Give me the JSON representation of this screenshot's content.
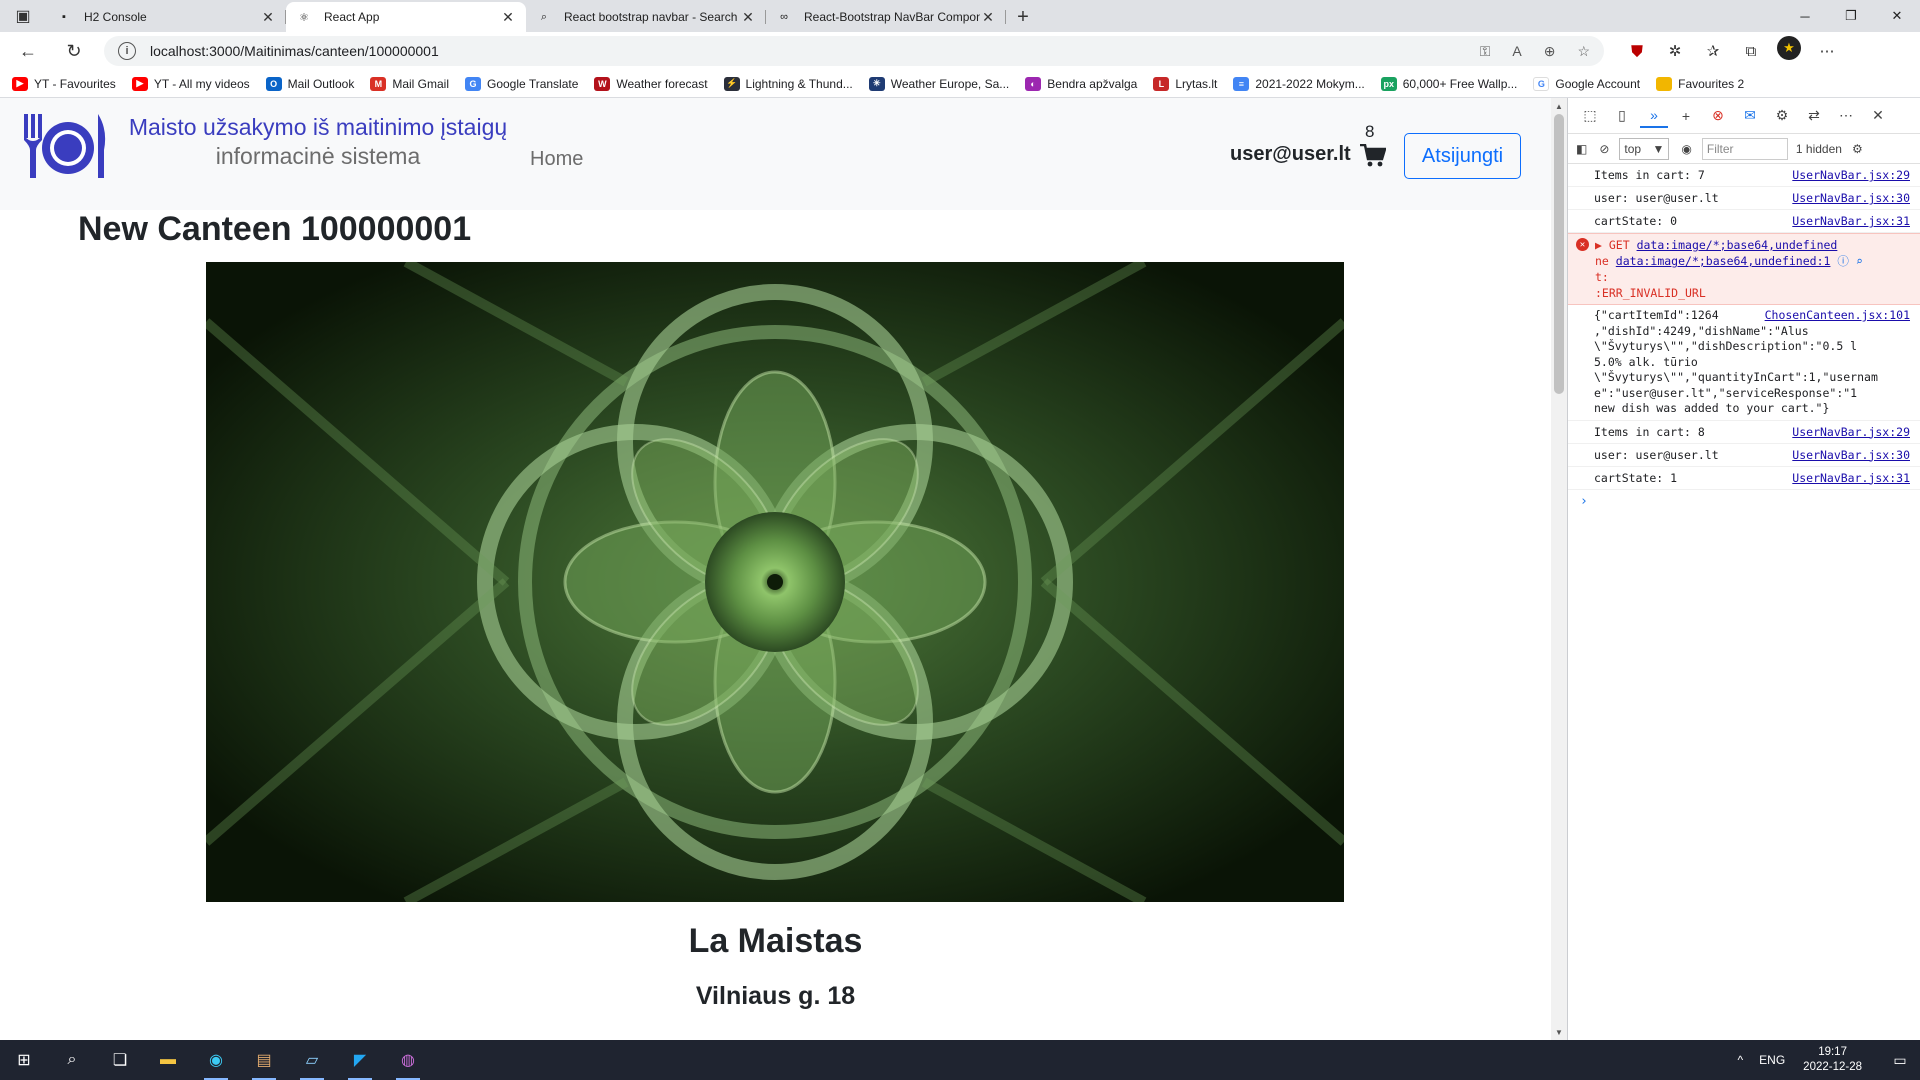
{
  "browser": {
    "tabs": [
      {
        "title": "H2 Console",
        "active": false,
        "icon": "h2-icon"
      },
      {
        "title": "React App",
        "active": true,
        "icon": "react-icon"
      },
      {
        "title": "React bootstrap navbar - Search",
        "active": false,
        "icon": "search-icon"
      },
      {
        "title": "React-Bootstrap NavBar Compon",
        "active": false,
        "icon": "link-icon"
      }
    ],
    "url": "localhost:3000/Maitinimas/canteen/100000001",
    "favorites": [
      {
        "label": "YT - Favourites",
        "color": "#ff0000",
        "glyph": "▶"
      },
      {
        "label": "YT - All my videos",
        "color": "#ff0000",
        "glyph": "▶"
      },
      {
        "label": "Mail Outlook",
        "color": "#0a64c8",
        "glyph": "O"
      },
      {
        "label": "Mail Gmail",
        "color": "#d93025",
        "glyph": "M"
      },
      {
        "label": "Google Translate",
        "color": "#4285f4",
        "glyph": "G"
      },
      {
        "label": "Weather forecast",
        "color": "#b3121b",
        "glyph": "W"
      },
      {
        "label": "Lightning & Thund...",
        "color": "#2b2f3a",
        "glyph": "⚡"
      },
      {
        "label": "Weather Europe, Sa...",
        "color": "#1f3b73",
        "glyph": "✳"
      },
      {
        "label": "Bendra apžvalga",
        "color": "#9c27b0",
        "glyph": "◐"
      },
      {
        "label": "Lrytas.lt",
        "color": "#c62828",
        "glyph": "L"
      },
      {
        "label": "2021-2022 Mokym...",
        "color": "#4285f4",
        "glyph": "≡"
      },
      {
        "label": "60,000+ Free Wallp...",
        "color": "#1aa260",
        "glyph": "px"
      },
      {
        "label": "Google Account",
        "color": "#ffffff",
        "glyph": "G"
      },
      {
        "label": "Favourites 2",
        "color": "#f2b600",
        "glyph": ""
      }
    ]
  },
  "site": {
    "brand_line1": "Maisto užsakymo iš maitinimo įstaigų",
    "brand_line2": "informacinė sistema",
    "nav_home": "Home",
    "user": "user@user.lt",
    "cart_count": "8",
    "logout_label": "Atsijungti",
    "canteen_title": "New Canteen 100000001",
    "canteen_name": "La Maistas",
    "canteen_address": "Vilniaus g. 18",
    "colors": {
      "brand": "#3a3dbf",
      "primary": "#0d6efd"
    }
  },
  "devtools": {
    "context": "top",
    "filter_placeholder": "Filter",
    "hidden": "1 hidden",
    "logs1": [
      {
        "msg": "Items in cart: 7",
        "src": "UserNavBar.jsx:29"
      },
      {
        "msg": "user: user@user.lt",
        "src": "UserNavBar.jsx:30"
      },
      {
        "msg": "cartState: 0",
        "src": "UserNavBar.jsx:31"
      }
    ],
    "error": {
      "method": "▶ GET",
      "url1": "data:image/*;base64,undefined",
      "prefix": "ne",
      "url2": "data:image/*;base64,undefined:1",
      "t": "t:",
      "code": ":ERR_INVALID_URL"
    },
    "json_log": {
      "lines": [
        "{\"cartItemId\":1264",
        ",\"dishId\":4249,\"dishName\":\"Alus",
        "\\\"Švyturys\\\"\",\"dishDescription\":\"0.5 l",
        "5.0% alk. tūrio",
        "\\\"Švyturys\\\"\",\"quantityInCart\":1,\"usernam",
        "e\":\"user@user.lt\",\"serviceResponse\":\"1",
        "new dish was added to your cart.\"}"
      ],
      "src": "ChosenCanteen.jsx:101"
    },
    "logs2": [
      {
        "msg": "Items in cart: 8",
        "src": "UserNavBar.jsx:29"
      },
      {
        "msg": "user: user@user.lt",
        "src": "UserNavBar.jsx:30"
      },
      {
        "msg": "cartState: 1",
        "src": "UserNavBar.jsx:31"
      }
    ]
  },
  "taskbar": {
    "lang": "ENG",
    "time": "19:17",
    "date": "2022-12-28"
  }
}
